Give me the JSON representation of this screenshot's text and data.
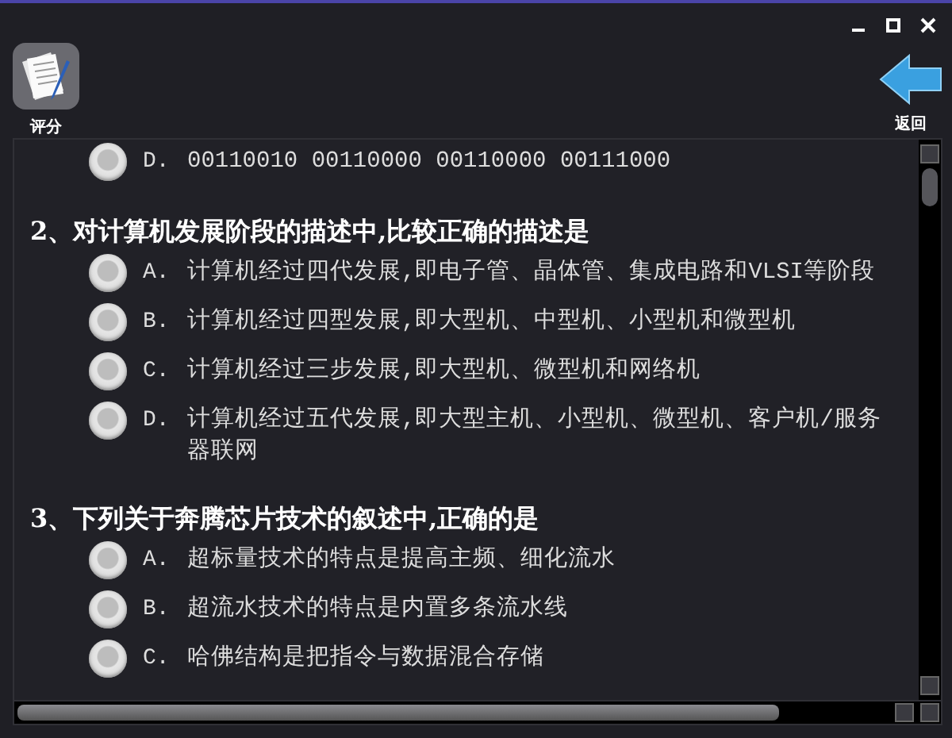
{
  "toolbar": {
    "grade_button": {
      "label": "评分"
    },
    "back_button": {
      "label": "返回"
    }
  },
  "questions": [
    {
      "options": [
        {
          "letter": "D.",
          "text": "00110010 00110000 00110000 00111000",
          "selected": false
        }
      ]
    },
    {
      "title": "2、对计算机发展阶段的描述中,比较正确的描述是",
      "options": [
        {
          "letter": "A.",
          "text": "计算机经过四代发展,即电子管、晶体管、集成电路和VLSI等阶段",
          "selected": false
        },
        {
          "letter": "B.",
          "text": "计算机经过四型发展,即大型机、中型机、小型机和微型机",
          "selected": false
        },
        {
          "letter": "C.",
          "text": "计算机经过三步发展,即大型机、微型机和网络机",
          "selected": false
        },
        {
          "letter": "D.",
          "text": "计算机经过五代发展,即大型主机、小型机、微型机、客户机/服务器联网",
          "selected": false
        }
      ]
    },
    {
      "title": "3、下列关于奔腾芯片技术的叙述中,正确的是",
      "options": [
        {
          "letter": "A.",
          "text": "超标量技术的特点是提高主频、细化流水",
          "selected": false
        },
        {
          "letter": "B.",
          "text": "超流水技术的特点是内置多条流水线",
          "selected": false
        },
        {
          "letter": "C.",
          "text": "哈佛结构是把指令与数据混合存储",
          "selected": false
        }
      ]
    }
  ]
}
